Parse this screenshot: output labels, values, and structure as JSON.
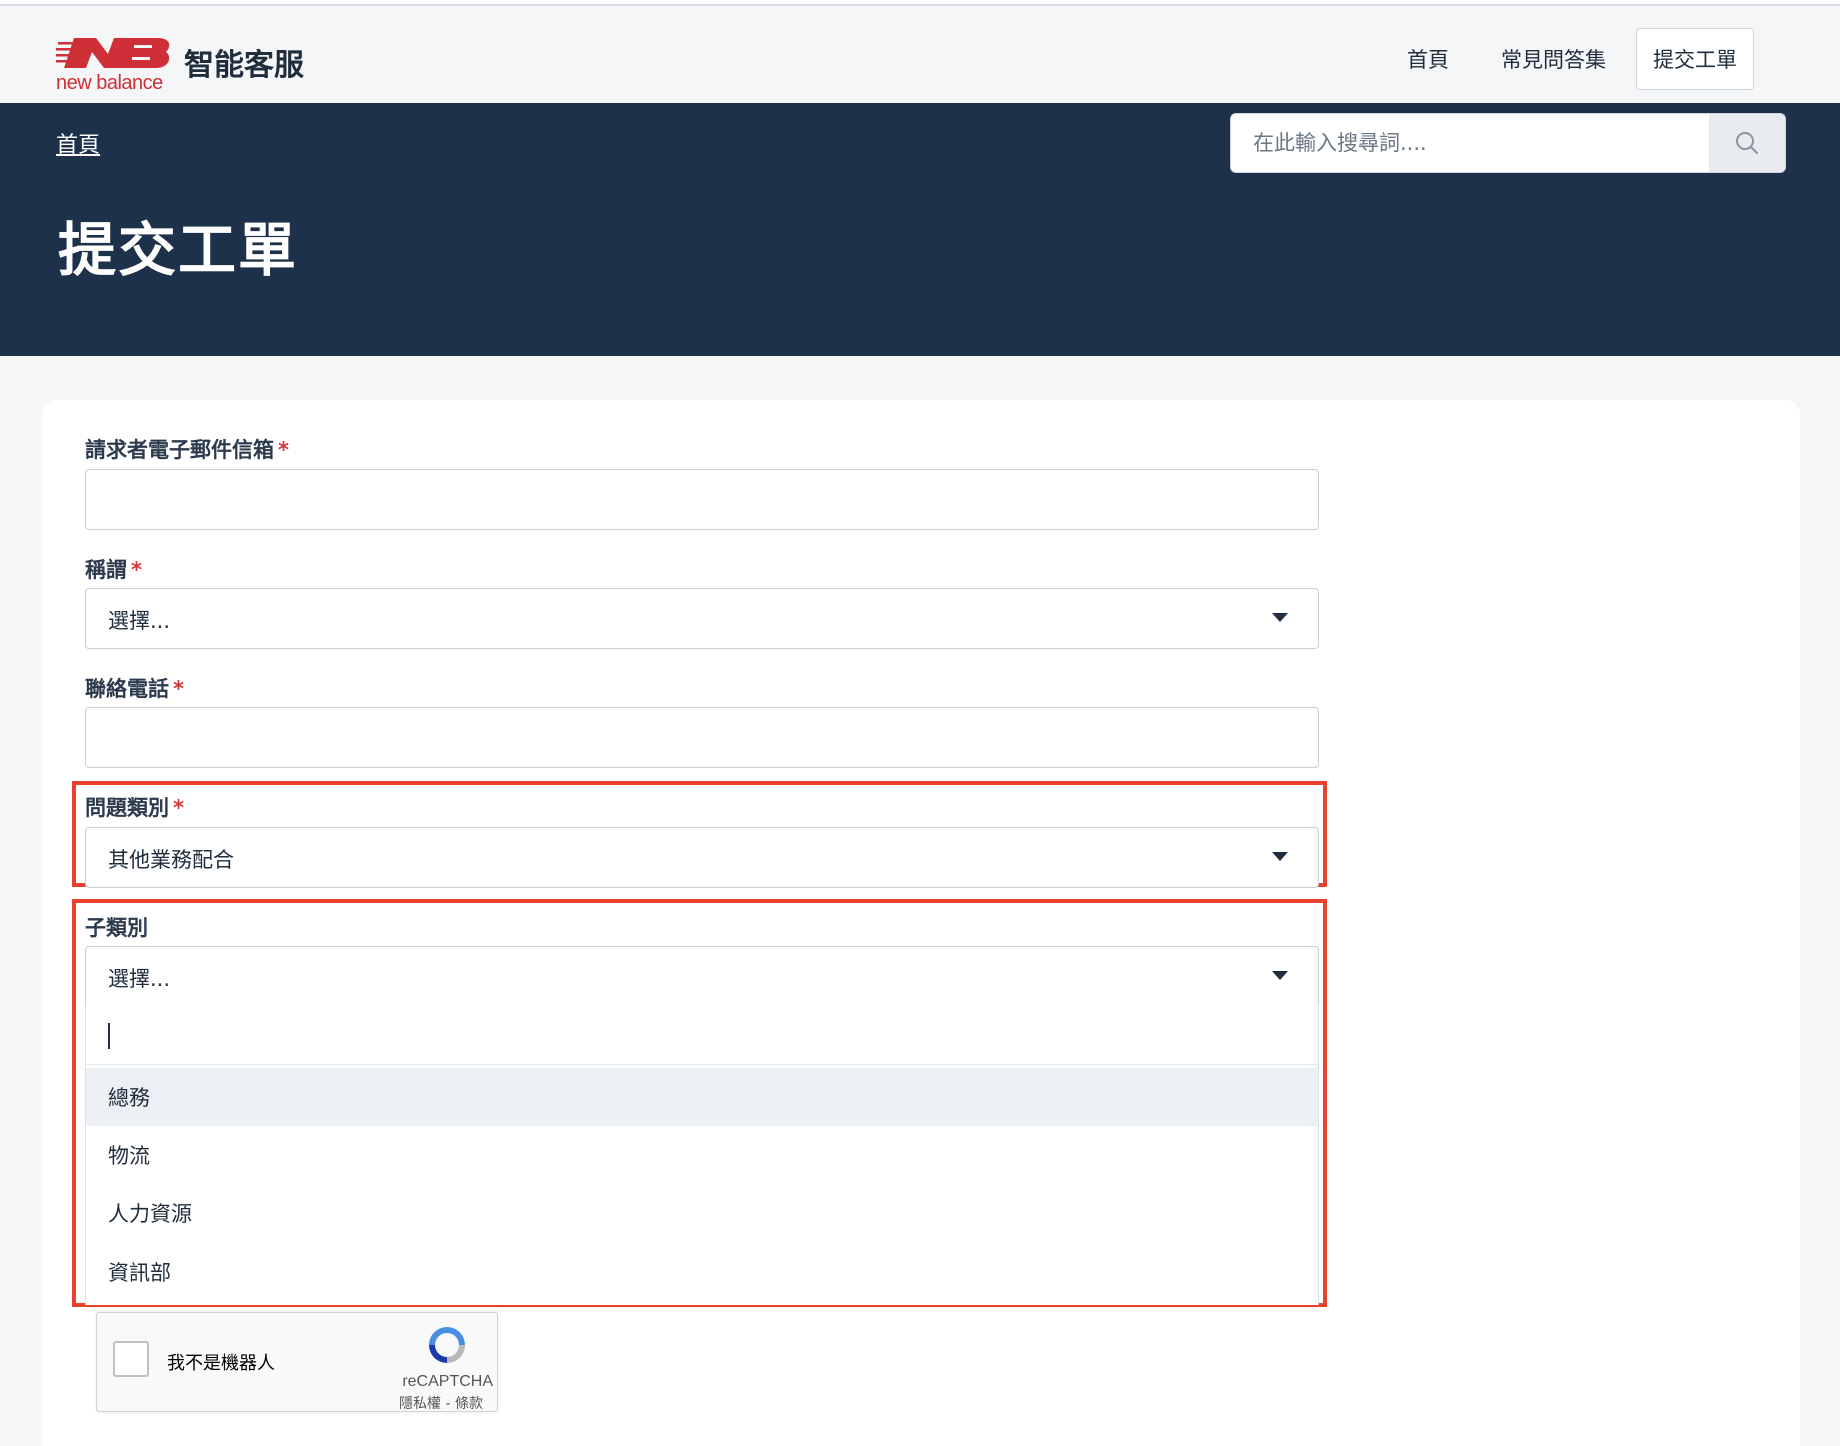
{
  "header": {
    "logo_text": "new balance",
    "brand_title": "智能客服",
    "nav": [
      "首頁",
      "常見問答集"
    ],
    "nav_button": "提交工單"
  },
  "hero": {
    "breadcrumb": "首頁",
    "title": "提交工單",
    "search_placeholder": "在此輸入搜尋詞...."
  },
  "form": {
    "email": {
      "label": "請求者電子郵件信箱",
      "required": "*",
      "value": ""
    },
    "salutation": {
      "label": "稱謂",
      "required": "*",
      "value": "選擇..."
    },
    "phone": {
      "label": "聯絡電話",
      "required": "*",
      "value": ""
    },
    "issue_category": {
      "label": "問題類別",
      "required": "*",
      "value": "其他業務配合"
    },
    "subcategory": {
      "label": "子類別",
      "value": "選擇...",
      "options": [
        "總務",
        "物流",
        "人力資源",
        "資訊部"
      ]
    }
  },
  "recaptcha": {
    "label": "我不是機器人",
    "brand": "reCAPTCHA",
    "links": "隱私權 - 條款"
  },
  "colors": {
    "hero_bg": "#1e314a",
    "brand_red": "#cf2f36",
    "highlight": "#e8412c",
    "required": "#d6383a"
  }
}
